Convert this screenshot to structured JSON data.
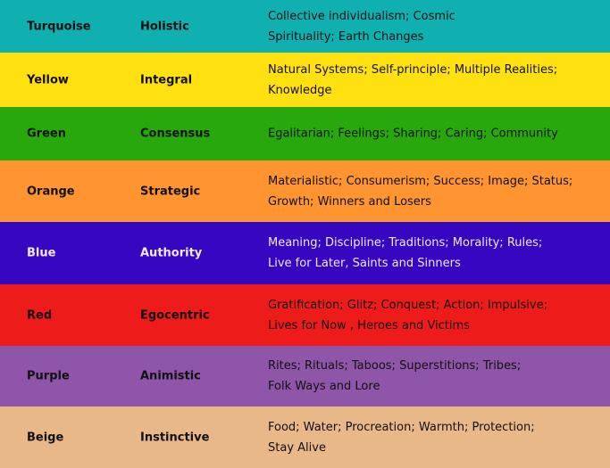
{
  "rows": [
    {
      "color": "Turquoise",
      "stage": "Holistic",
      "desc": [
        "Collective individualism; Cosmic",
        "Spirituality; Earth Changes"
      ],
      "bg": "#10b0b0",
      "fg": "#111111"
    },
    {
      "color": "Yellow",
      "stage": "Integral",
      "desc": [
        "Natural Systems; Self-principle; Multiple Realities;",
        "Knowledge"
      ],
      "bg": "#ffe010",
      "fg": "#111111"
    },
    {
      "color": "Green",
      "stage": "Consensus",
      "desc": [
        "Egalitarian; Feelings; Sharing; Caring; Community"
      ],
      "bg": "#28a80c",
      "fg": "#111111"
    },
    {
      "color": "Orange",
      "stage": "Strategic",
      "desc": [
        "Materialistic; Consumerism; Success; Image; Status;",
        "Growth; Winners and Losers"
      ],
      "bg": "#fe9530",
      "fg": "#111111"
    },
    {
      "color": "Blue",
      "stage": "Authority",
      "desc": [
        "Meaning; Discipline; Traditions; Morality; Rules;",
        "Live for Later, Saints and Sinners"
      ],
      "bg": "#3606c0",
      "fg": "#f0e8ff"
    },
    {
      "color": "Red",
      "stage": "Egocentric",
      "desc": [
        "Gratification; Glitz; Conquest; Action; Impulsive;",
        "Lives for Now , Heroes and Victims"
      ],
      "bg": "#ee1b1b",
      "fg": "#111111"
    },
    {
      "color": "Purple",
      "stage": "Animistic",
      "desc": [
        "Rites; Rituals; Taboos; Superstitions; Tribes;",
        "Folk Ways and Lore"
      ],
      "bg": "#8e55a8",
      "fg": "#111111"
    },
    {
      "color": "Beige",
      "stage": "Instinctive",
      "desc": [
        "Food; Water; Procreation; Warmth; Protection;",
        "Stay Alive"
      ],
      "bg": "#e8b888",
      "fg": "#111111"
    }
  ]
}
